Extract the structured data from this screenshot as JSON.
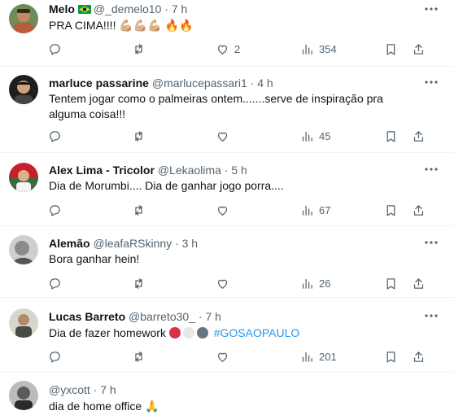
{
  "tweets": [
    {
      "name": "Melo",
      "handle": "@_demelo10",
      "time": "7 h",
      "text": "PRA CIMA!!!! 💪🏼💪🏼💪🏼 🔥🔥",
      "hashtag": "",
      "replies": "",
      "retweets": "",
      "likes": "2",
      "views": "354",
      "avatar_color": "#b85c3a"
    },
    {
      "name": "marluce passarine",
      "handle": "@marlucepassari1",
      "time": "4 h",
      "text": "Tentem jogar como o palmeiras ontem.......serve de inspiração pra alguma coisa!!!",
      "hashtag": "",
      "replies": "",
      "retweets": "",
      "likes": "",
      "views": "45",
      "avatar_color": "#2c2c2c"
    },
    {
      "name": "Alex Lima - Tricolor",
      "handle": "@Lekaolima",
      "time": "5 h",
      "text": "Dia de Morumbi.... Dia de ganhar jogo porra....",
      "hashtag": "",
      "replies": "",
      "retweets": "",
      "likes": "",
      "views": "67",
      "avatar_color": "#3b6b3a"
    },
    {
      "name": "Alemão",
      "handle": "@leafaRSkinny",
      "time": "3 h",
      "text": "Bora ganhar hein!",
      "hashtag": "",
      "replies": "",
      "retweets": "",
      "likes": "",
      "views": "26",
      "avatar_color": "#777777"
    },
    {
      "name": "Lucas Barreto",
      "handle": "@barreto30_",
      "time": "7 h",
      "text": "Dia de fazer homework",
      "hashtag": "#GOSAOPAULO",
      "replies": "",
      "retweets": "",
      "likes": "",
      "views": "201",
      "avatar_color": "#8a8a7a"
    },
    {
      "name": "",
      "handle": "@yxcott",
      "time": "7 h",
      "text": "dia de home office 🙏",
      "hashtag": "",
      "replies": "",
      "retweets": "",
      "likes": "",
      "views": "",
      "avatar_color": "#5a5a5a"
    }
  ],
  "separator": "·",
  "colors": {
    "text": "#0f1419",
    "secondary": "#536471",
    "link": "#1d9bf0",
    "divider": "#eff3f4",
    "emoji_red": "#dd2e44",
    "emoji_white": "#e6e7e8",
    "emoji_black": "#66757f"
  },
  "icons": [
    "reply-icon",
    "retweet-icon",
    "like-icon",
    "views-icon",
    "bookmark-icon",
    "share-icon",
    "more-icon",
    "brazil-flag-icon"
  ]
}
